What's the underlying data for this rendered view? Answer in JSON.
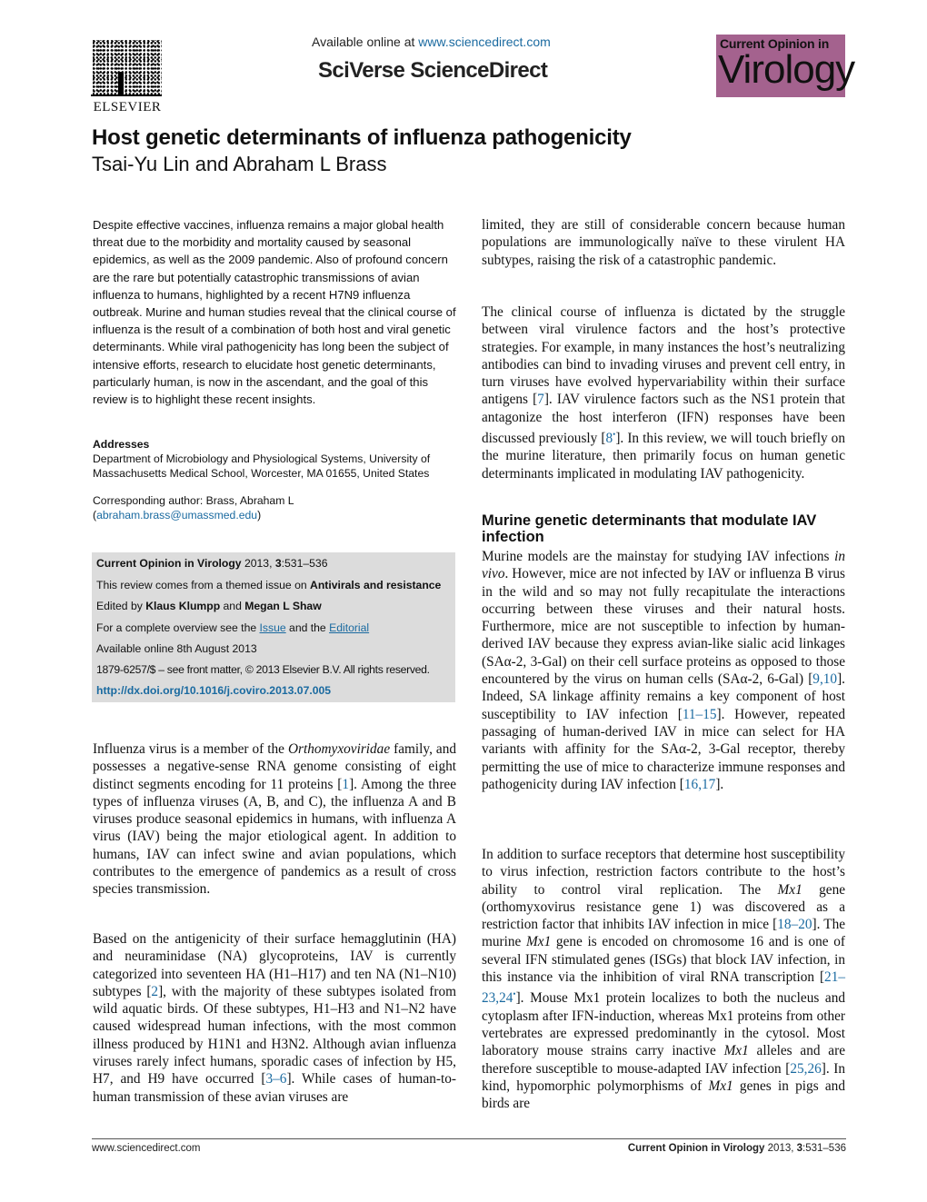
{
  "header": {
    "publisher": "ELSEVIER",
    "available_prefix": "Available online at ",
    "available_link": "www.sciencedirect.com",
    "platform": "SciVerse ScienceDirect",
    "journal_logo_line1": "Current Opinion in",
    "journal_logo_line2": "Virology",
    "journal_logo_color": "#a4628e"
  },
  "article": {
    "title": "Host genetic determinants of influenza pathogenicity",
    "authors": "Tsai-Yu Lin and Abraham L Brass"
  },
  "abstract": "Despite effective vaccines, influenza remains a major global health threat due to the morbidity and mortality caused by seasonal epidemics, as well as the 2009 pandemic. Also of profound concern are the rare but potentially catastrophic transmissions of avian influenza to humans, highlighted by a recent H7N9 influenza outbreak. Murine and human studies reveal that the clinical course of influenza is the result of a combination of both host and viral genetic determinants. While viral pathogenicity has long been the subject of intensive efforts, research to elucidate host genetic determinants, particularly human, is now in the ascendant, and the goal of this review is to highlight these recent insights.",
  "addresses": {
    "heading": "Addresses",
    "line1": "Department of Microbiology and Physiological Systems, University of",
    "line2": "Massachusetts Medical School, Worcester, MA 01655, United States"
  },
  "corresponding": {
    "label": "Corresponding author: Brass, Abraham L",
    "open": "(",
    "email": "abraham.brass@umassmed.edu",
    "close": ")"
  },
  "infobox": {
    "journal": "Current Opinion in Virology",
    "year_vol": " 2013, ",
    "volume": "3",
    "pages": ":531–536",
    "theme_prefix": "This review comes from a themed issue on ",
    "theme": "Antivirals and resistance",
    "edited_prefix": "Edited by ",
    "editor1": "Klaus Klumpp",
    "edited_and": " and ",
    "editor2": "Megan L Shaw",
    "overview_prefix": "For a complete overview see the ",
    "issue_link": "Issue",
    "overview_and": " and the ",
    "editorial_link": "Editorial",
    "available": "Available online 8th August 2013",
    "copyright": "1879-6257/$ – see front matter, © 2013 Elsevier B.V. All rights reserved.",
    "doi": "http://dx.doi.org/10.1016/j.coviro.2013.07.005"
  },
  "body": {
    "left_p1": {
      "a": "Influenza virus is a member of the ",
      "i": "Orthomyxoviridae",
      "b": " family, and possesses a negative-sense RNA genome consisting of eight distinct segments encoding for 11 proteins [",
      "c1": "1",
      "c": "]. Among the three types of influenza viruses (A, B, and C), the influenza A and B viruses produce seasonal epidemics in humans, with influenza A virus (IAV) being the major etiological agent. In addition to humans, IAV can infect swine and avian populations, which contributes to the emergence of pandemics as a result of cross species transmission."
    },
    "left_p2": {
      "a": "Based on the antigenicity of their surface hemagglutinin (HA) and neuraminidase (NA) glycoproteins, IAV is currently categorized into seventeen HA (H1–H17) and ten NA (N1–N10) subtypes [",
      "c1": "2",
      "b": "], with the majority of these subtypes isolated from wild aquatic birds. Of these subtypes, H1–H3 and N1–N2 have caused widespread human infections, with the most common illness produced by H1N1 and H3N2. Although avian influenza viruses rarely infect humans, sporadic cases of infection by H5, H7, and H9 have occurred [",
      "c2": "3–6",
      "c": "]. While cases of human-to-human transmission of these avian viruses are"
    },
    "right_p1": "limited, they are still of considerable concern because human populations are immunologically naïve to these virulent HA subtypes, raising the risk of a catastrophic pandemic.",
    "right_p2": {
      "a": "The clinical course of influenza is dictated by the struggle between viral virulence factors and the host’s protective strategies. For example, in many instances the host’s neutralizing antibodies can bind to invading viruses and prevent cell entry, in turn viruses have evolved hypervariability within their surface antigens [",
      "c1": "7",
      "b": "]. IAV virulence factors such as the NS1 protein that antagonize the host interferon (IFN) responses have been discussed previously [",
      "c2": "8",
      "c2_mark": "•",
      "c": "]. In this review, we will touch briefly on the murine literature, then primarily focus on human genetic determinants implicated in modulating IAV pathogenicity."
    },
    "section_heading": "Murine genetic determinants that modulate IAV infection",
    "right_p3": {
      "a": "Murine models are the mainstay for studying IAV infections ",
      "i": "in vivo",
      "b": ". However, mice are not infected by IAV or influenza B virus in the wild and so may not fully recapitulate the interactions occurring between these viruses and their natural hosts. Furthermore, mice are not susceptible to infection by human-derived IAV because they express avian-like sialic acid linkages (SAα-2, 3-Gal) on their cell surface proteins as opposed to those encountered by the virus on human cells (SAα-2, 6-Gal) [",
      "c1": "9,10",
      "c": "]. Indeed, SA linkage affinity remains a key component of host susceptibility to IAV infection [",
      "c2": "11–15",
      "d": "]. However, repeated passaging of human-derived IAV in mice can select for HA variants with affinity for the SAα-2, 3-Gal receptor, thereby permitting the use of mice to characterize immune responses and pathogenicity during IAV infection [",
      "c3": "16,17",
      "e": "]."
    },
    "right_p4": {
      "a": "In addition to surface receptors that determine host susceptibility to virus infection, restriction factors contribute to the host’s ability to control viral replication. The ",
      "i1": "Mx1",
      "b": " gene (orthomyxovirus resistance gene 1) was discovered as a restriction factor that inhibits IAV infection in mice [",
      "c1": "18–20",
      "c": "]. The murine ",
      "i2": "Mx1",
      "d": " gene is encoded on chromosome 16 and is one of several IFN stimulated genes (ISGs) that block IAV infection, in this instance via the inhibition of viral RNA transcription [",
      "c2": "21–23,24",
      "c2_mark": "•",
      "e": "]. Mouse Mx1 protein localizes to both the nucleus and cytoplasm after IFN-induction, whereas Mx1 proteins from other vertebrates are expressed predominantly in the cytosol. Most laboratory mouse strains carry inactive ",
      "i3": "Mx1",
      "f": " alleles and are therefore susceptible to mouse-adapted IAV infection [",
      "c3": "25,26",
      "g": "]. In kind, hypomorphic polymorphisms of ",
      "i4": "Mx1",
      "h": " genes in pigs and birds are"
    }
  },
  "footer": {
    "left": "www.sciencedirect.com",
    "journal": "Current Opinion in Virology",
    "year": " 2013, ",
    "volume": "3",
    "pages": ":531–536"
  }
}
